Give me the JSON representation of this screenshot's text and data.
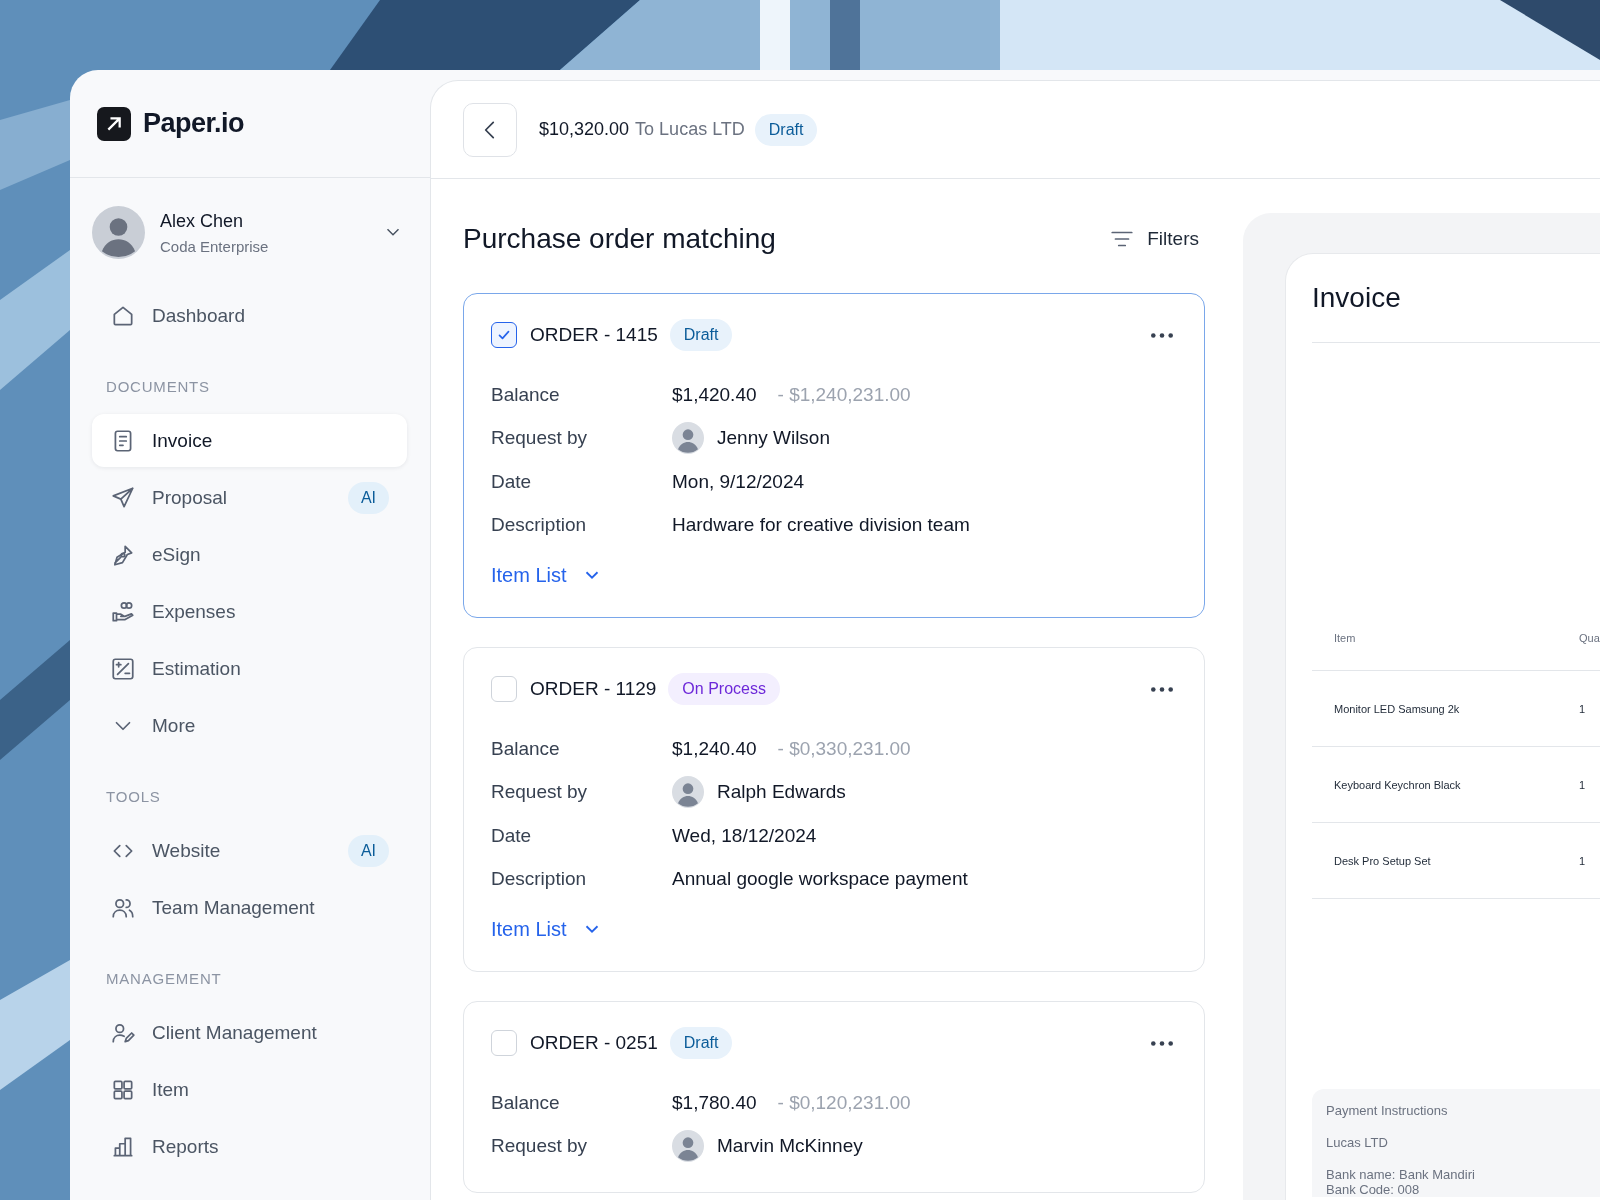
{
  "brand": {
    "name": "Paper.io"
  },
  "user": {
    "name": "Alex Chen",
    "company": "Coda Enterprise"
  },
  "nav": [
    {
      "items": [
        {
          "label": "Dashboard",
          "selected": false
        }
      ]
    },
    {
      "heading": "DOCUMENTS",
      "items": [
        {
          "label": "Invoice",
          "selected": true
        },
        {
          "label": "Proposal",
          "selected": false,
          "badge": "AI"
        },
        {
          "label": "eSign",
          "selected": false
        },
        {
          "label": "Expenses",
          "selected": false
        },
        {
          "label": "Estimation",
          "selected": false
        },
        {
          "label": "More",
          "selected": false
        }
      ]
    },
    {
      "heading": "TOOLS",
      "items": [
        {
          "label": "Website",
          "selected": false,
          "badge": "AI"
        },
        {
          "label": "Team Management",
          "selected": false
        }
      ]
    },
    {
      "heading": "MANAGEMENT",
      "items": [
        {
          "label": "Client Management",
          "selected": false
        },
        {
          "label": "Item",
          "selected": false
        },
        {
          "label": "Reports",
          "selected": false
        }
      ]
    }
  ],
  "header": {
    "amount": "$10,320.00",
    "recipient": "To Lucas LTD",
    "status": {
      "label": "Draft",
      "kind": "draft"
    }
  },
  "page_title": "Purchase order matching",
  "filters_label": "Filters",
  "orders": [
    {
      "number": "ORDER - 1415",
      "checked": true,
      "status": {
        "label": "Draft",
        "kind": "draft"
      },
      "fields": [
        {
          "kind": "amount",
          "label": "Balance",
          "value": "$1,420.40",
          "secondary": "- $1,240,231.00"
        },
        {
          "kind": "person",
          "label": "Request by",
          "value": "Jenny Wilson"
        },
        {
          "kind": "text",
          "label": "Date",
          "value": "Mon, 9/12/2024"
        },
        {
          "kind": "text",
          "label": "Description",
          "value": "Hardware for creative division team"
        }
      ],
      "link": "Item List"
    },
    {
      "number": "ORDER - 1129",
      "checked": false,
      "status": {
        "label": "On Process",
        "kind": "process"
      },
      "fields": [
        {
          "kind": "amount",
          "label": "Balance",
          "value": "$1,240.40",
          "secondary": "- $0,330,231.00"
        },
        {
          "kind": "person",
          "label": "Request by",
          "value": "Ralph Edwards"
        },
        {
          "kind": "text",
          "label": "Date",
          "value": "Wed, 18/12/2024"
        },
        {
          "kind": "text",
          "label": "Description",
          "value": "Annual google workspace payment"
        }
      ],
      "link": "Item List"
    },
    {
      "number": "ORDER - 0251",
      "checked": false,
      "status": {
        "label": "Draft",
        "kind": "draft"
      },
      "fields": [
        {
          "kind": "amount",
          "label": "Balance",
          "value": "$1,780.40",
          "secondary": "- $0,120,231.00"
        },
        {
          "kind": "person",
          "label": "Request by",
          "value": "Marvin McKinney"
        }
      ]
    }
  ],
  "invoice": {
    "title": "Invoice",
    "columns": [
      "Item",
      "Qua"
    ],
    "rows": [
      [
        "Monitor LED Samsung 2k",
        "1"
      ],
      [
        "Keyboard Keychron Black",
        "1"
      ],
      [
        "Desk Pro Setup Set",
        "1"
      ]
    ],
    "payment": {
      "title": "Payment Instructions",
      "company": "Lucas LTD",
      "details": [
        "Bank name: Bank Mandiri",
        "Bank Code: 008"
      ]
    }
  }
}
